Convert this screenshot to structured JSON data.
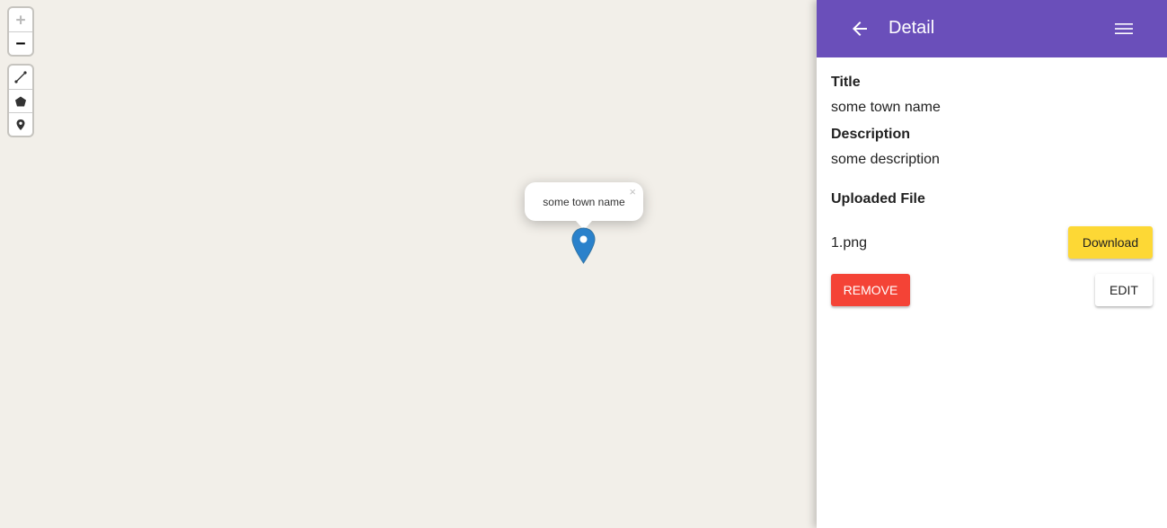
{
  "map": {
    "background": "#f2efe9",
    "zoom_in_label": "+",
    "zoom_out_label": "−",
    "popup": {
      "text": "some town name",
      "close_label": "×"
    },
    "marker_color": "#2a81cb"
  },
  "panel": {
    "header_color": "#6a4fba",
    "title": "Detail",
    "fields": {
      "title_label": "Title",
      "title_value": "some town name",
      "description_label": "Description",
      "description_value": "some description",
      "file_label": "Uploaded File",
      "file_name": "1.png"
    },
    "buttons": {
      "download": "Download",
      "remove": "REMOVE",
      "edit": "EDIT"
    }
  }
}
